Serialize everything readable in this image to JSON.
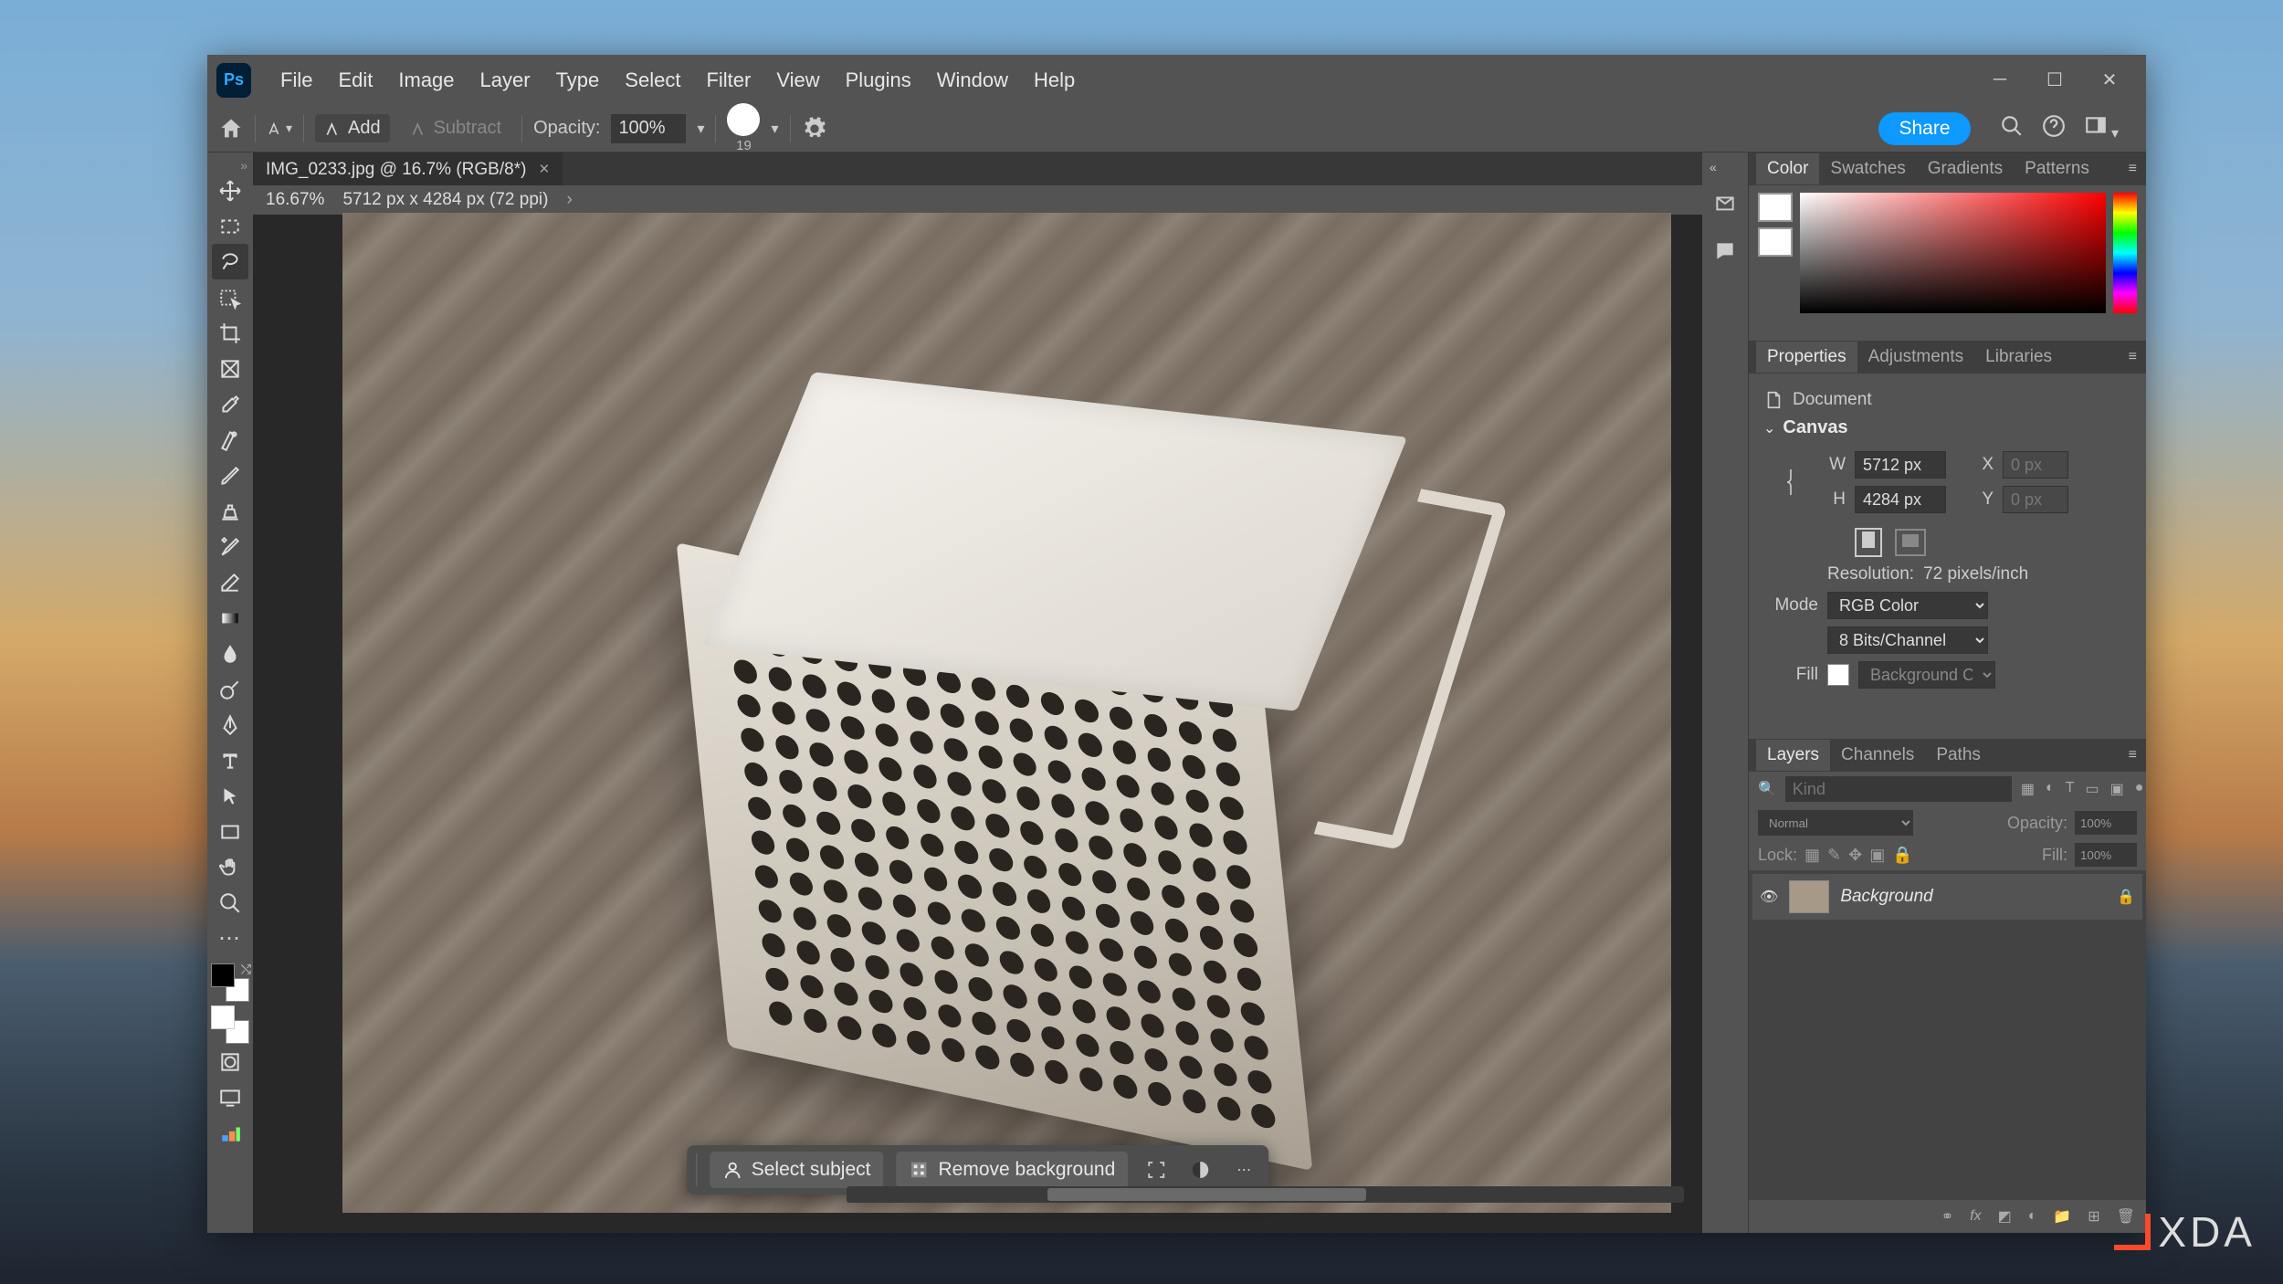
{
  "app_icon": "Ps",
  "menu": [
    "File",
    "Edit",
    "Image",
    "Layer",
    "Type",
    "Select",
    "Filter",
    "View",
    "Plugins",
    "Window",
    "Help"
  ],
  "options_bar": {
    "add": "Add",
    "subtract": "Subtract",
    "opacity_label": "Opacity:",
    "opacity_value": "100%",
    "brush_size": "19"
  },
  "share": "Share",
  "doc_tab": "IMG_0233.jpg @ 16.7% (RGB/8*)",
  "bottom_bar": {
    "select_subject": "Select subject",
    "remove_bg": "Remove background"
  },
  "status": {
    "zoom": "16.67%",
    "dims": "5712 px x 4284 px (72 ppi)"
  },
  "color_tabs": [
    "Color",
    "Swatches",
    "Gradients",
    "Patterns"
  ],
  "prop_tabs": [
    "Properties",
    "Adjustments",
    "Libraries"
  ],
  "properties": {
    "doc_label": "Document",
    "canvas_label": "Canvas",
    "w_label": "W",
    "h_label": "H",
    "x_label": "X",
    "y_label": "Y",
    "w": "5712 px",
    "h": "4284 px",
    "x": "0 px",
    "y": "0 px",
    "res_label": "Resolution:",
    "res_value": "72 pixels/inch",
    "mode_label": "Mode",
    "mode_value": "RGB Color",
    "bits_value": "8 Bits/Channel",
    "fill_label": "Fill",
    "fill_value": "Background Color"
  },
  "layers_tabs": [
    "Layers",
    "Channels",
    "Paths"
  ],
  "layers": {
    "kind_placeholder": "Kind",
    "blend_mode": "Normal",
    "opacity_label": "Opacity:",
    "opacity_value": "100%",
    "lock_label": "Lock:",
    "fill_label": "Fill:",
    "fill_value": "100%",
    "bg_layer": "Background"
  },
  "watermark": "XDA"
}
